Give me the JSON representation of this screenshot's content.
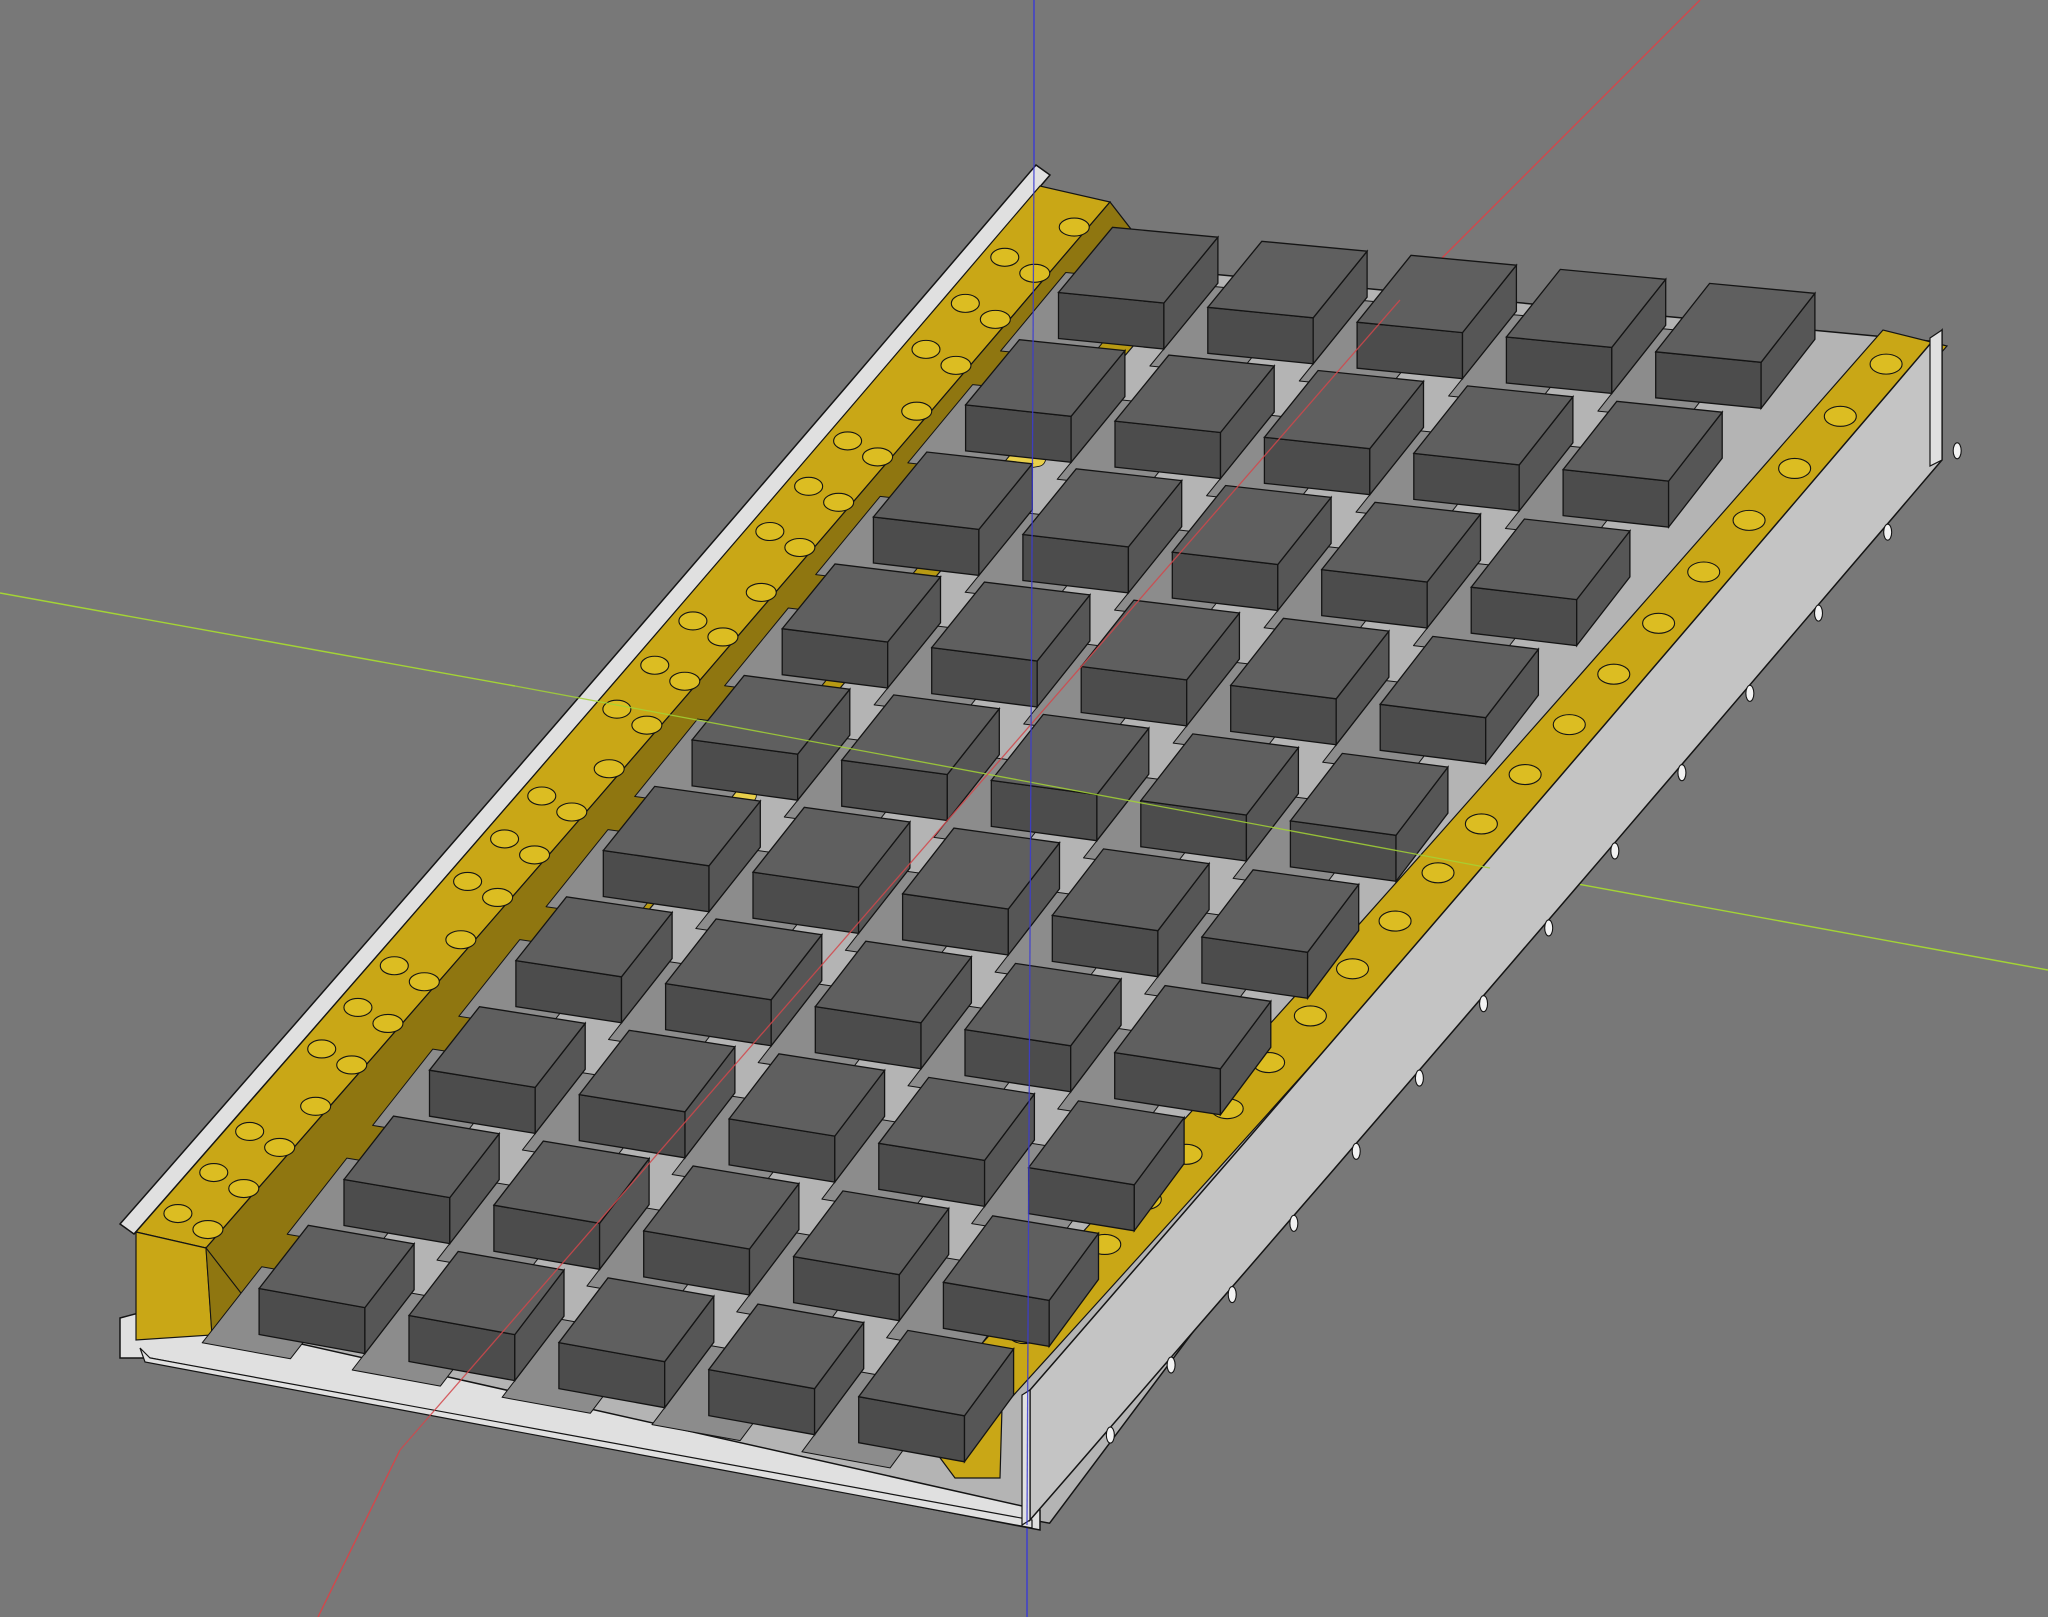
{
  "viewport": {
    "background_color": "#787878",
    "axes": {
      "x_axis_color": "#d2474b",
      "y_axis_color": "#a4d435",
      "z_axis_color": "#3b3bd4"
    },
    "model": {
      "frame_color": "#e0e0e0",
      "frame_edge_color": "#141414",
      "rail_color": "#c9a716",
      "rail_shadow_color": "#8f7610",
      "rail_top_color": "#b89a13",
      "hole_color": "#dcbd22",
      "peg_color": "#e8cf4a",
      "block_top_color": "#5f5f5f",
      "block_side_color": "#4c4c4c",
      "block_end_color": "#565656",
      "floor_color": "#b4b4b4",
      "pocket_color": "#8c8c8c",
      "side_plate_color": "#c4c4c4",
      "side_plate_hole_color": "#f2f2f2",
      "block_rows": 10,
      "block_columns": 5
    }
  }
}
